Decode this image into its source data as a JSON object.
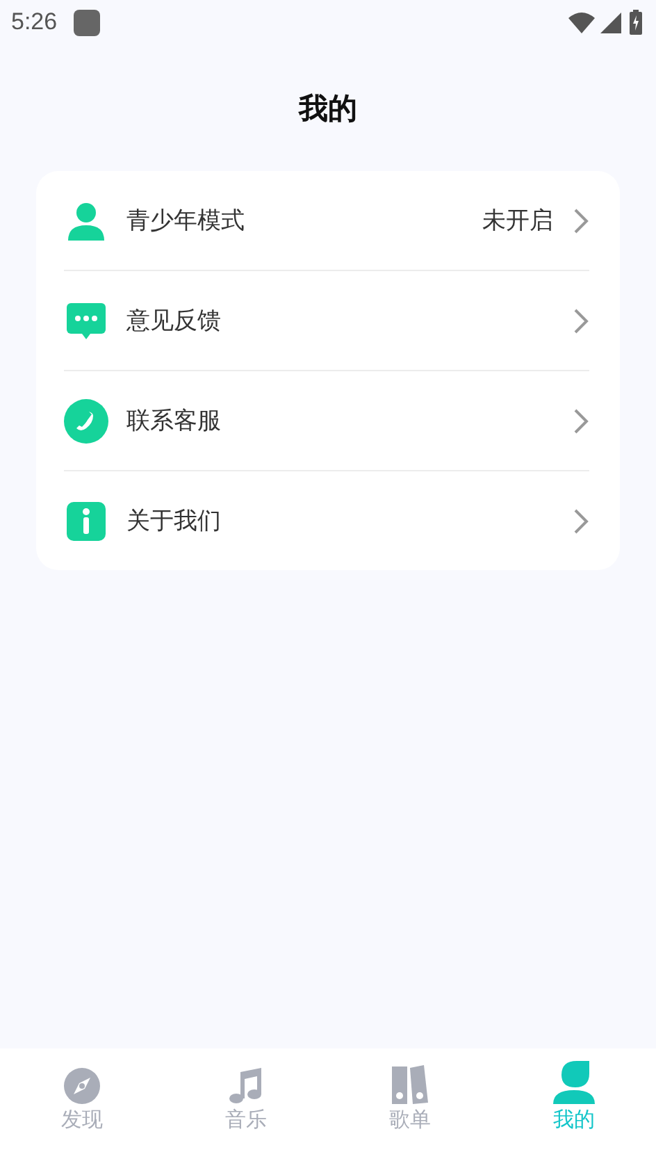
{
  "status_bar": {
    "time": "5:26"
  },
  "page_title": "我的",
  "menu": [
    {
      "kind": "person",
      "label": "青少年模式",
      "value": "未开启"
    },
    {
      "kind": "chat",
      "label": "意见反馈"
    },
    {
      "kind": "phone",
      "label": "联系客服"
    },
    {
      "kind": "info",
      "label": "关于我们"
    }
  ],
  "tabs": [
    {
      "kind": "compass",
      "label": "发现",
      "selected": false
    },
    {
      "kind": "music",
      "label": "音乐",
      "selected": false
    },
    {
      "kind": "books",
      "label": "歌单",
      "selected": false
    },
    {
      "kind": "person",
      "label": "我的",
      "selected": true
    }
  ]
}
